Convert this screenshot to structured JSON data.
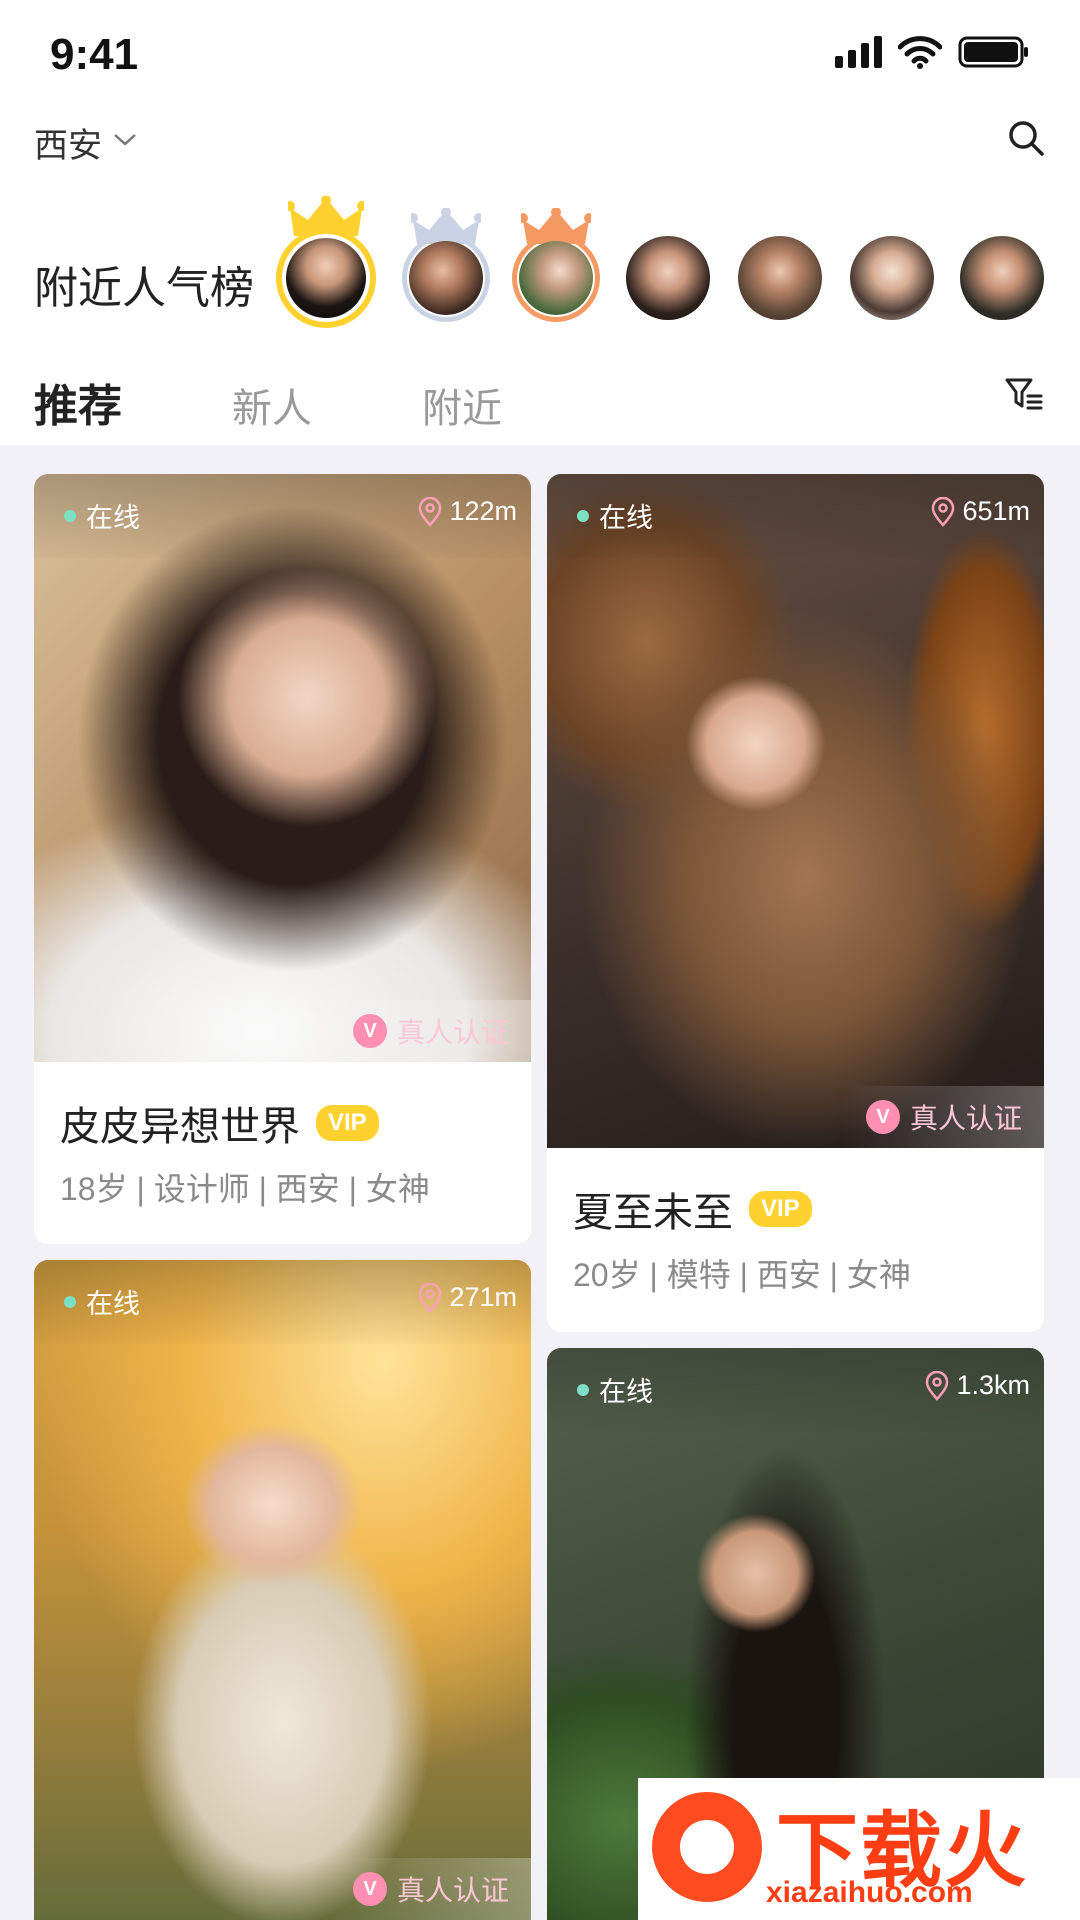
{
  "status_bar": {
    "time": "9:41"
  },
  "header": {
    "city": "西安"
  },
  "popular": {
    "title": "附近人气榜",
    "avatars": [
      {
        "rank": 1,
        "crown": "gold-crown-icon",
        "ring_color": "#ffd12e"
      },
      {
        "rank": 2,
        "crown": "silver-crown-icon",
        "ring_color": "#c9d3e4"
      },
      {
        "rank": 3,
        "crown": "bronze-crown-icon",
        "ring_color": "#f59a62"
      },
      {
        "rank": 4
      },
      {
        "rank": 5
      },
      {
        "rank": 6
      },
      {
        "rank": 7
      }
    ]
  },
  "tabs": [
    {
      "label": "推荐",
      "active": true
    },
    {
      "label": "新人",
      "active": false
    },
    {
      "label": "附近",
      "active": false
    }
  ],
  "cards": [
    {
      "online": "在线",
      "distance": "122m",
      "verified": "真人认证",
      "name": "皮皮异想世界",
      "vip": "VIP",
      "meta": "18岁 | 设计师 |  西安 | 女神"
    },
    {
      "online": "在线",
      "distance": "651m",
      "verified": "真人认证",
      "name": "夏至未至",
      "vip": "VIP",
      "meta": "20岁 | 模特 |  西安 | 女神"
    },
    {
      "online": "在线",
      "distance": "271m",
      "verified": "真人认证"
    },
    {
      "online": "在线",
      "distance": "1.3km"
    }
  ],
  "watermark": {
    "text": "下载火",
    "url": "xiazaihuo.com"
  },
  "colors": {
    "accent_vip": "#ffd12e",
    "online_dot": "#7ce0c2",
    "verified_pink": "#ff8fb0",
    "watermark_red": "#ff3d12"
  }
}
